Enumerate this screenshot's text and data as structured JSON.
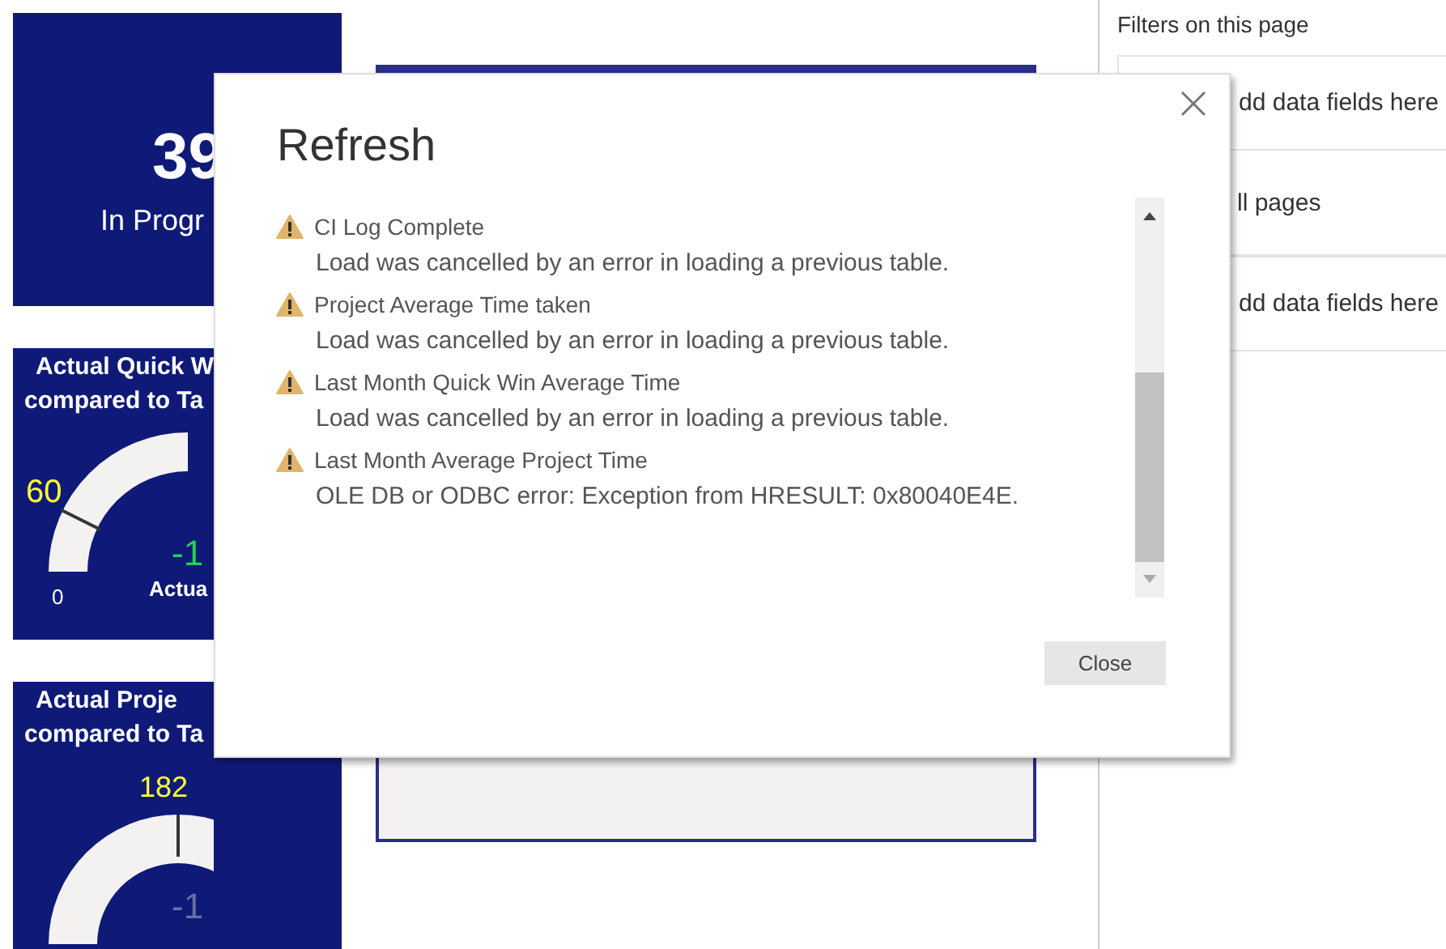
{
  "tiles": [
    {
      "kind": "card",
      "value": "39",
      "label": "In Progr"
    },
    {
      "kind": "half_gauge",
      "title_lines": [
        "Actual Quick W",
        "compared to Ta"
      ],
      "target": "60",
      "min": "0",
      "value": "-1",
      "value_label": "Actua"
    },
    {
      "kind": "ring_gauge",
      "title_lines": [
        "Actual Proje",
        "compared to Ta"
      ],
      "target": "182",
      "value": "-1"
    }
  ],
  "filters_pane": {
    "heading": "Filters on this page",
    "items": [
      {
        "kind": "well",
        "text": "dd data fields here"
      },
      {
        "kind": "heading",
        "text": "ll pages"
      },
      {
        "kind": "well",
        "text": "dd data fields here"
      }
    ]
  },
  "dialog": {
    "title": "Refresh",
    "items": [
      {
        "name": "CI Log Complete",
        "message": "Load was cancelled by an error in loading a previous table."
      },
      {
        "name": "Project Average Time taken",
        "message": "Load was cancelled by an error in loading a previous table."
      },
      {
        "name": "Last Month Quick Win Average Time",
        "message": "Load was cancelled by an error in loading a previous table."
      },
      {
        "name": "Last Month Average Project Time",
        "message": "OLE DB or ODBC error: Exception from HRESULT: 0x80040E4E."
      }
    ],
    "button": "Close"
  }
}
